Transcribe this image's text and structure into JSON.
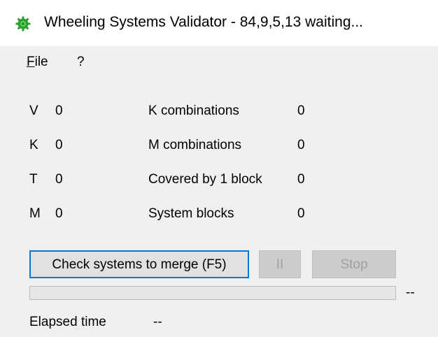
{
  "window": {
    "title": "Wheeling Systems Validator - 84,9,5,13 waiting...",
    "icon": "green-gear-icon"
  },
  "menu": {
    "file_accel": "F",
    "file_rest": "ile",
    "help": "?"
  },
  "params": [
    {
      "label": "V",
      "value": "0"
    },
    {
      "label": "K",
      "value": "0"
    },
    {
      "label": "T",
      "value": "0"
    },
    {
      "label": "M",
      "value": "0"
    }
  ],
  "stats": [
    {
      "label": "K combinations",
      "value": "0"
    },
    {
      "label": "M combinations",
      "value": "0"
    },
    {
      "label": "Covered by 1 block",
      "value": "0"
    },
    {
      "label": "System blocks",
      "value": "0"
    }
  ],
  "buttons": {
    "check": "Check systems to merge (F5)",
    "pause": "II",
    "stop": "Stop"
  },
  "progress": {
    "fraction": 0,
    "text": "--"
  },
  "elapsed": {
    "label": "Elapsed time",
    "value": "--"
  },
  "colors": {
    "accent": "#0078d7",
    "progress_fill": "#06b025",
    "icon_green": "#2e9e2e"
  }
}
